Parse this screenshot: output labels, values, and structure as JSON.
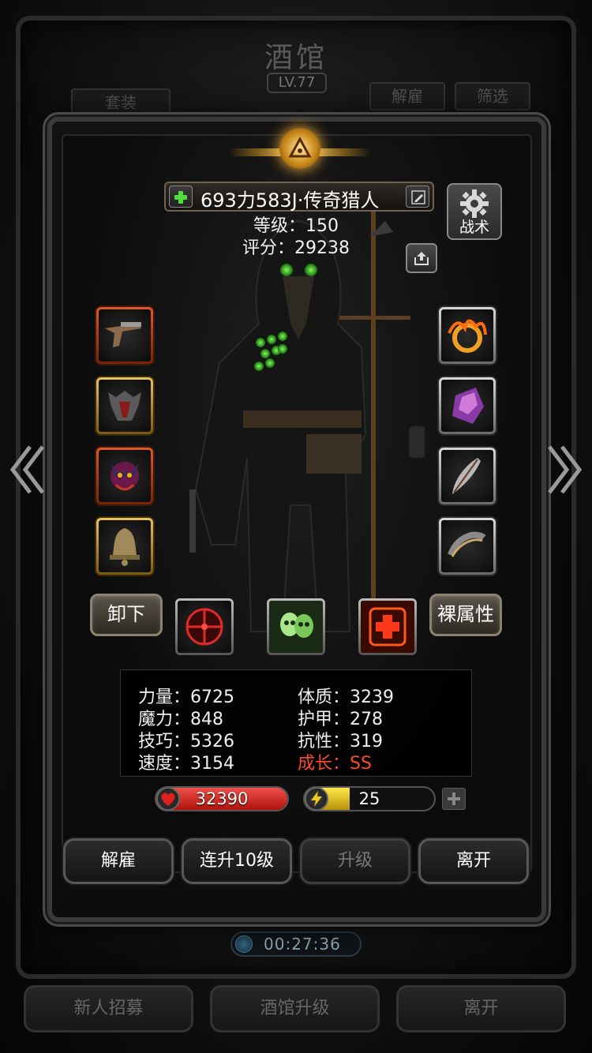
{
  "background": {
    "title": "酒馆",
    "level": "LV.77",
    "set_button": "套装",
    "dismiss_button": "解雇",
    "filter_button": "筛选",
    "timer": "00:27:36",
    "bottom_buttons": [
      "新人招募",
      "酒馆升级",
      "离开"
    ]
  },
  "hero": {
    "name": "693力583J·传奇猎人",
    "level_text": "等级：150",
    "score_text": "评分：29238",
    "tactics_label": "战术"
  },
  "equipment": {
    "left": [
      "flintlock-pistol",
      "spiked-armor",
      "demon-amulet",
      "bronze-bell"
    ],
    "right": [
      "flame-ring",
      "purple-crystal",
      "silver-feather",
      "bone-bracelet"
    ],
    "left_rarity": [
      "red",
      "gold",
      "red",
      "gold"
    ],
    "right_rarity": [
      "silver",
      "silver",
      "silver",
      "silver"
    ]
  },
  "actions": {
    "unequip": "卸下",
    "base_attributes": "裸属性"
  },
  "skills": [
    "crosshair-skill",
    "skull-skill",
    "heal-cross-skill"
  ],
  "stats": {
    "strength": "力量：6725",
    "magic": "魔力：848",
    "skill": "技巧：5326",
    "speed": "速度：3154",
    "constitution": "体质：3239",
    "armor": "护甲：278",
    "resistance": "抗性：319",
    "growth": "成长：SS"
  },
  "bars": {
    "hp": "32390",
    "energy": "25",
    "energy_fill": 0.35,
    "hp_fill": 1.0
  },
  "dialog_buttons": {
    "dismiss": "解雇",
    "level_up_10": "连升10级",
    "level_up": "升级",
    "leave": "离开"
  },
  "colors": {
    "growth": "#ff4a2a",
    "hp_bar": "#d8231c",
    "energy_bar": "#f2c81c"
  }
}
